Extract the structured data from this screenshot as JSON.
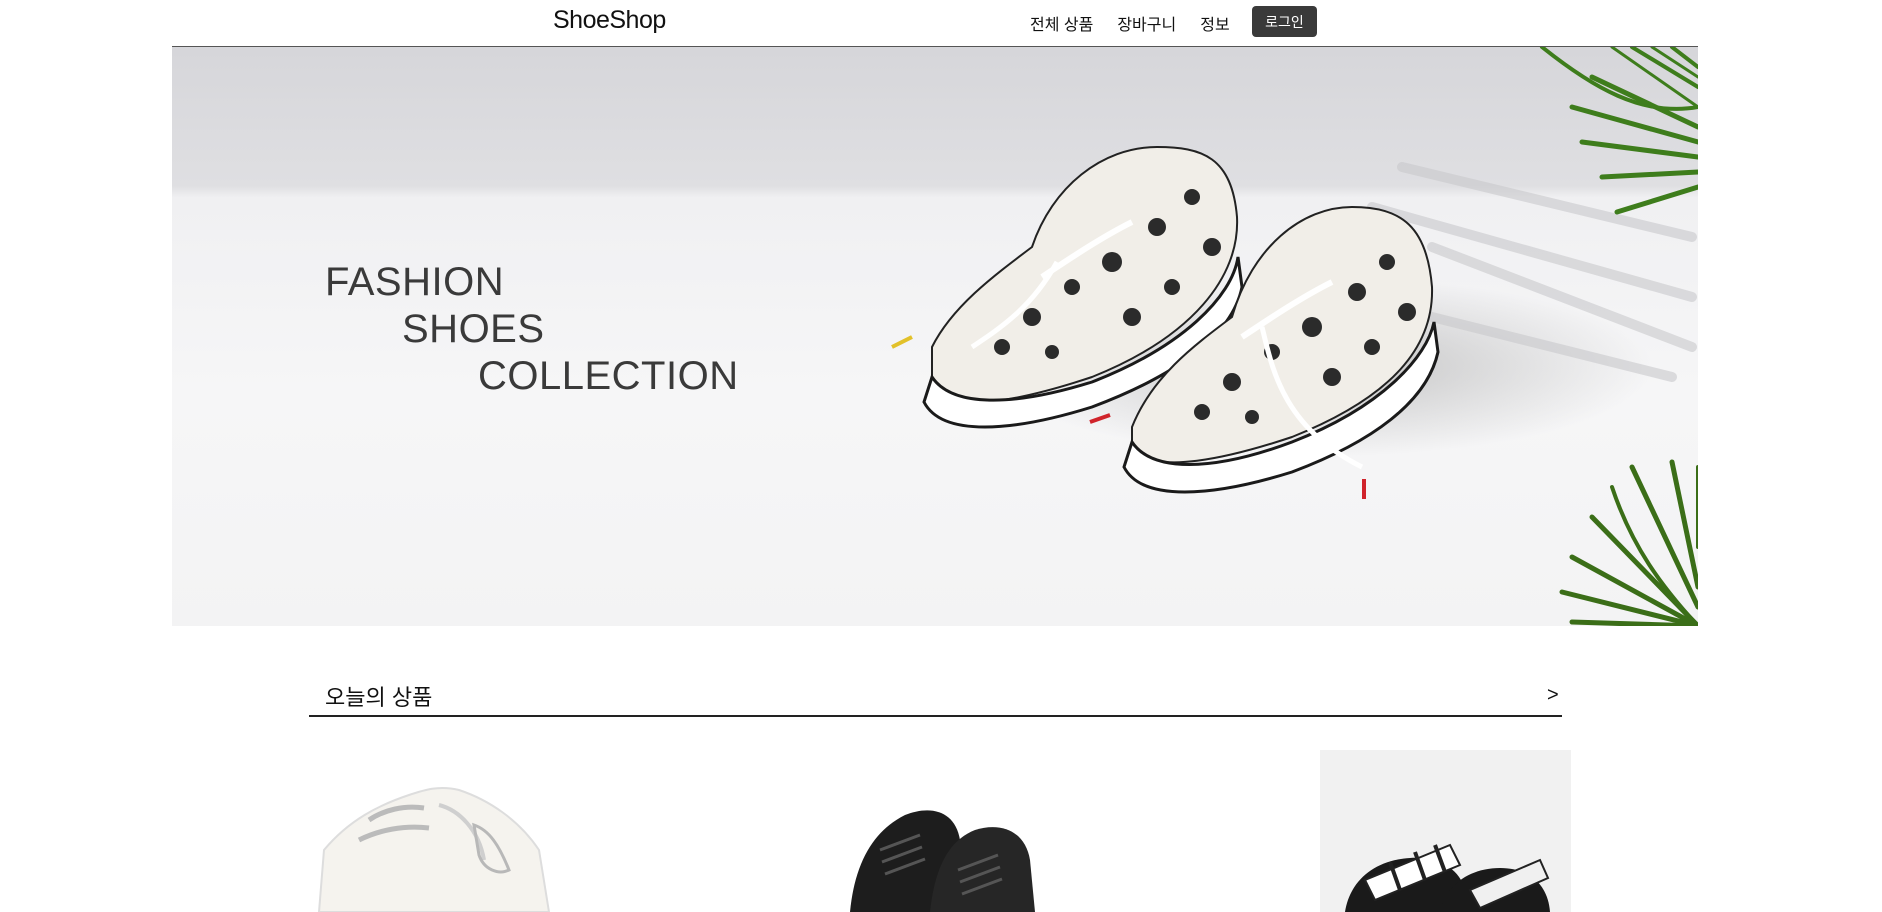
{
  "header": {
    "logo": "ShoeShop",
    "nav": [
      {
        "label": "전체 상품"
      },
      {
        "label": "장바구니"
      },
      {
        "label": "정보"
      }
    ],
    "login_label": "로그인"
  },
  "hero": {
    "line1": "FASHION",
    "line2": "SHOES",
    "line3": "COLLECTION"
  },
  "today": {
    "title": "오늘의 상품",
    "more": ">"
  },
  "colors": {
    "login_bg": "#3a3a3a",
    "hero_bg": "#f2f2f4",
    "leaf": "#3e7d1c"
  },
  "products": [
    {
      "icon": "white-sneaker-image"
    },
    {
      "icon": "black-leather-shoe-image"
    },
    {
      "icon": "slide-sandal-image"
    }
  ]
}
